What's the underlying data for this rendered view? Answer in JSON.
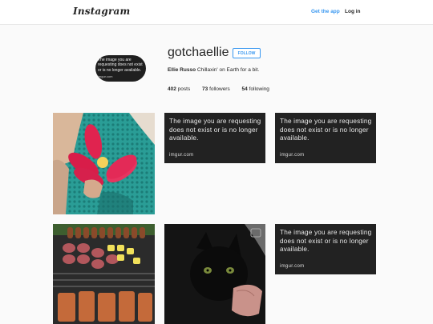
{
  "header": {
    "logo": "Instagram",
    "get_app": "Get the app",
    "login": "Log in"
  },
  "profile": {
    "avatar_message": "The image you are requesting does not exist or is no longer available.",
    "avatar_brand": "imgur.com",
    "username": "gotchaellie",
    "follow_label": "FOLLOW",
    "full_name": "Ellie Russo",
    "bio": "Chillaxin' on Earth for a bit.",
    "stats": [
      {
        "value": "402",
        "label": "posts"
      },
      {
        "value": "73",
        "label": "followers"
      },
      {
        "value": "54",
        "label": "following"
      }
    ]
  },
  "posts": {
    "missing_message": "The image you are requesting does not exist or is no longer available.",
    "missing_brand": "imgur.com",
    "items": [
      {
        "kind": "photo",
        "subject": "red flower on teal knit blanket"
      },
      {
        "kind": "missing"
      },
      {
        "kind": "missing"
      },
      {
        "kind": "photo",
        "subject": "grilled food on barbecue"
      },
      {
        "kind": "photo",
        "subject": "black kitten held in hand"
      },
      {
        "kind": "missing"
      }
    ]
  },
  "colors": {
    "accent": "#3897f0",
    "page_bg": "#fafafa",
    "missing_bg": "#222222"
  }
}
